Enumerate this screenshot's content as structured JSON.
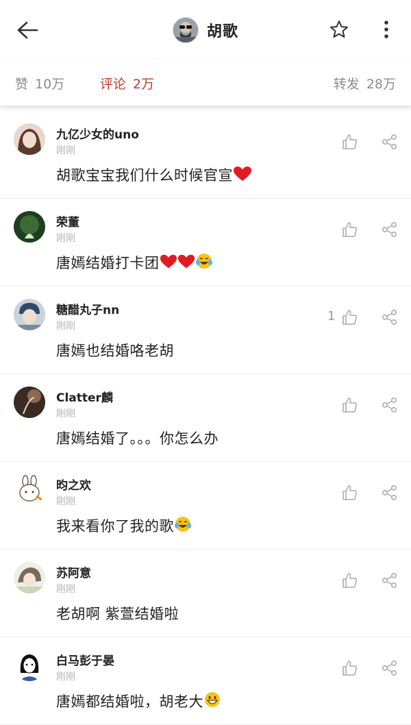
{
  "header": {
    "title": "胡歌",
    "back_icon": "arrow-left-icon",
    "star_icon": "star-outline-icon",
    "more_icon": "more-vertical-icon"
  },
  "stats": {
    "likes": {
      "label": "赞",
      "count": "10万"
    },
    "comments": {
      "label": "评论",
      "count": "2万"
    },
    "reposts": {
      "label": "转发",
      "count": "28万"
    }
  },
  "colors": {
    "accent": "#c0392b",
    "muted": "#8d8d8d"
  },
  "comments": [
    {
      "name": "九亿少女的uno",
      "time": "刚刚",
      "text": "胡歌宝宝我们什么时候官宣",
      "emojis": [
        "red-heart"
      ],
      "likes": ""
    },
    {
      "name": "荣董",
      "time": "刚刚",
      "text": "唐嫣结婚打卡团",
      "emojis": [
        "red-heart",
        "red-heart",
        "laughing-crying-face"
      ],
      "likes": ""
    },
    {
      "name": "糖醋丸子nn",
      "time": "刚刚",
      "text": "唐嫣也结婚咯老胡",
      "emojis": [],
      "likes": "1"
    },
    {
      "name": "Clatter麟",
      "time": "刚刚",
      "text": "唐嫣结婚了。。。你怎么办",
      "emojis": [],
      "likes": ""
    },
    {
      "name": "昀之欢",
      "time": "刚刚",
      "text": "我来看你了我的歌",
      "emojis": [
        "laughing-crying-face"
      ],
      "likes": ""
    },
    {
      "name": "苏阿意",
      "time": "刚刚",
      "text": "老胡啊 紫萱结婚啦",
      "emojis": [],
      "likes": ""
    },
    {
      "name": "白马彭于晏",
      "time": "刚刚",
      "text": "唐嫣都结婚啦，胡老大",
      "emojis": [
        "grinning-face"
      ],
      "likes": ""
    }
  ]
}
